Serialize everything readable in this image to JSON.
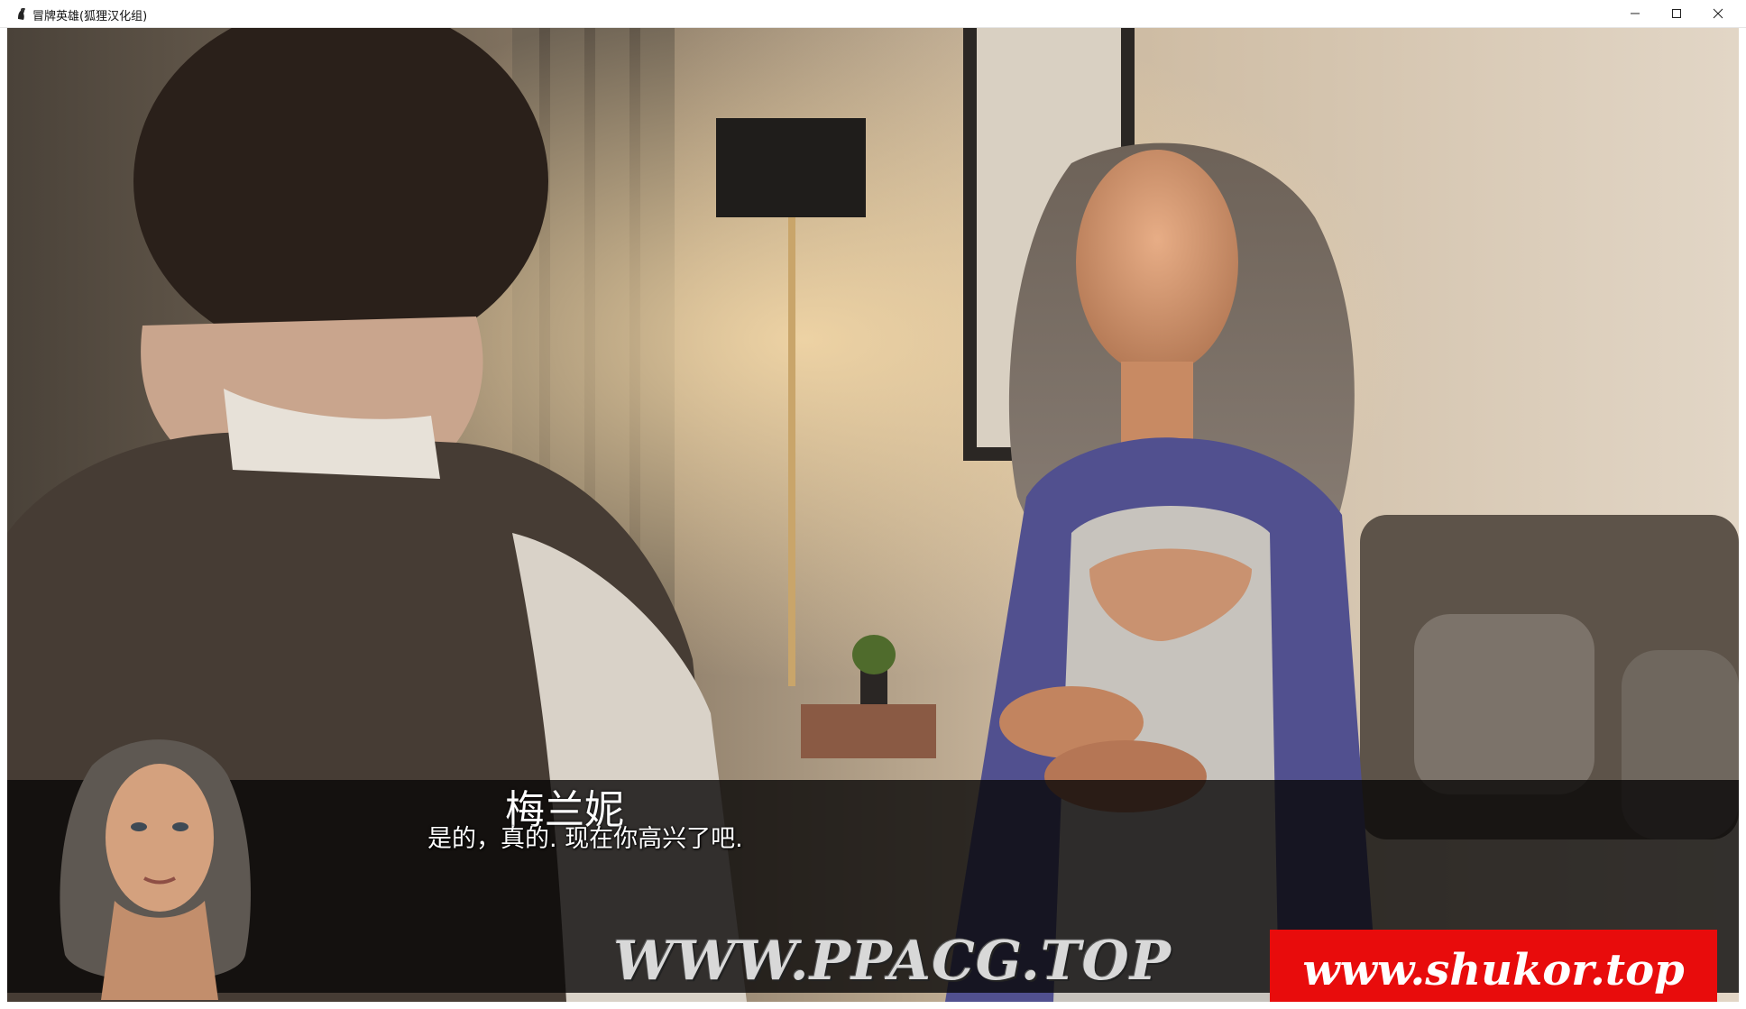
{
  "window": {
    "title": "冒牌英雄(狐狸汉化组)",
    "app_icon": "app-icon",
    "controls": [
      "minimize-icon",
      "maximize-icon",
      "close-icon"
    ]
  },
  "dialogue": {
    "speaker": "梅兰妮",
    "text": "是的，真的. 现在你高兴了吧."
  },
  "watermarks": {
    "left": "WWW.PPACG.TOP",
    "right": "www.shukor.top"
  },
  "colors": {
    "textbox_bg": "#080606",
    "watermark_red": "#e80c0c",
    "dialogue_text": "#ffffff"
  }
}
